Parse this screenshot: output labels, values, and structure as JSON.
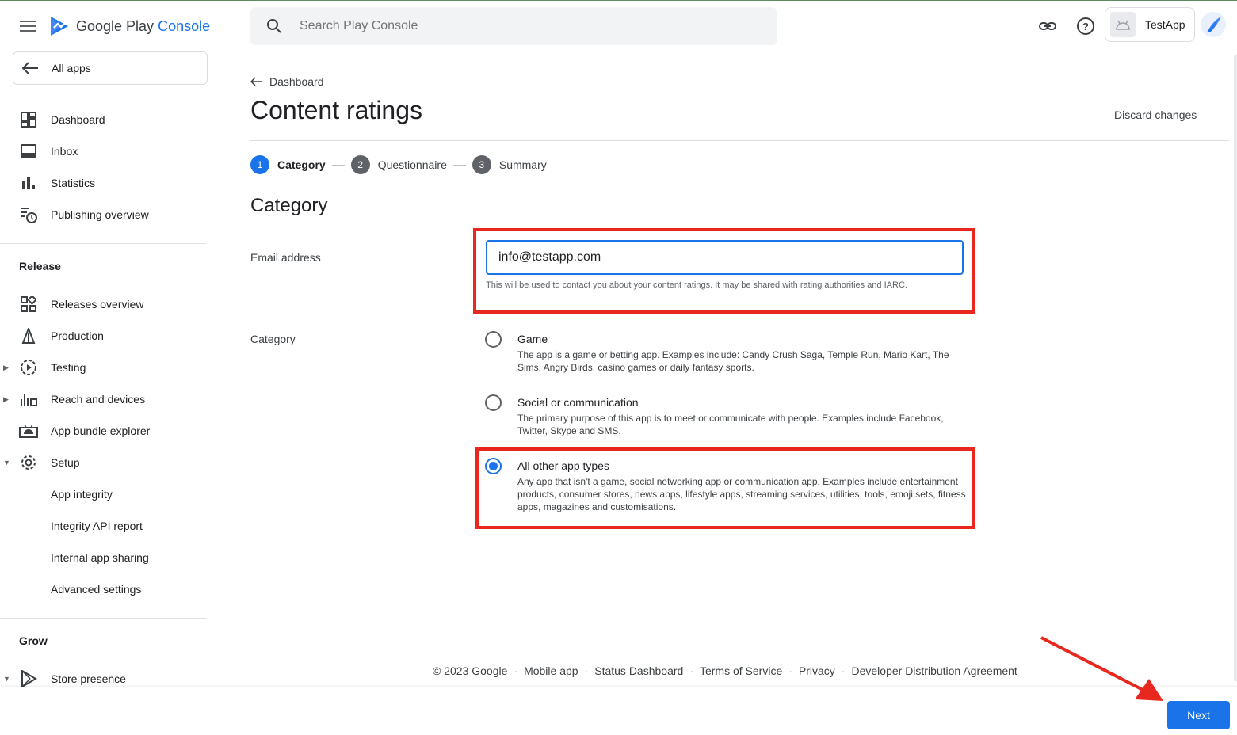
{
  "header": {
    "logo_google_play": "Google Play",
    "logo_console": "Console",
    "search_placeholder": "Search Play Console",
    "app_name": "TestApp"
  },
  "sidebar": {
    "all_apps": "All apps",
    "top_items": [
      {
        "label": "Dashboard",
        "icon": "dashboard-icon"
      },
      {
        "label": "Inbox",
        "icon": "inbox-icon"
      },
      {
        "label": "Statistics",
        "icon": "statistics-icon"
      },
      {
        "label": "Publishing overview",
        "icon": "publishing-overview-icon"
      }
    ],
    "release_title": "Release",
    "release_items": [
      {
        "label": "Releases overview",
        "icon": "releases-overview-icon"
      },
      {
        "label": "Production",
        "icon": "production-icon"
      },
      {
        "label": "Testing",
        "icon": "testing-icon"
      },
      {
        "label": "Reach and devices",
        "icon": "reach-devices-icon"
      },
      {
        "label": "App bundle explorer",
        "icon": "app-bundle-icon"
      },
      {
        "label": "Setup",
        "icon": "setup-gear-icon"
      },
      {
        "label": "App integrity"
      },
      {
        "label": "Integrity API report"
      },
      {
        "label": "Internal app sharing"
      },
      {
        "label": "Advanced settings"
      }
    ],
    "grow_title": "Grow",
    "grow_items": [
      {
        "label": "Store presence",
        "icon": "store-presence-icon"
      }
    ]
  },
  "main": {
    "breadcrumb": "Dashboard",
    "title": "Content ratings",
    "discard": "Discard changes",
    "steps": [
      {
        "num": "1",
        "label": "Category"
      },
      {
        "num": "2",
        "label": "Questionnaire"
      },
      {
        "num": "3",
        "label": "Summary"
      }
    ],
    "section_title": "Category",
    "email_label": "Email address",
    "email_value": "info@testapp.com",
    "email_helper": "This will be used to contact you about your content ratings. It may be shared with rating authorities and IARC.",
    "category_label": "Category",
    "options": [
      {
        "title": "Game",
        "desc": "The app is a game or betting app. Examples include: Candy Crush Saga, Temple Run, Mario Kart, The Sims, Angry Birds, casino games or daily fantasy sports.",
        "checked": false
      },
      {
        "title": "Social or communication",
        "desc": "The primary purpose of this app is to meet or communicate with people. Examples include Facebook, Twitter, Skype and SMS.",
        "checked": false
      },
      {
        "title": "All other app types",
        "desc": "Any app that isn't a game, social networking app or communication app. Examples include entertainment products, consumer stores, news apps, lifestyle apps, streaming services, utilities, tools, emoji sets, fitness apps, magazines and customisations.",
        "checked": true
      }
    ]
  },
  "footer": {
    "copyright": "© 2023 Google",
    "links": [
      "Mobile app",
      "Status Dashboard",
      "Terms of Service",
      "Privacy",
      "Developer Distribution Agreement"
    ]
  },
  "next_button": "Next",
  "colors": {
    "accent": "#1a73e8",
    "highlight": "#e8281e"
  }
}
